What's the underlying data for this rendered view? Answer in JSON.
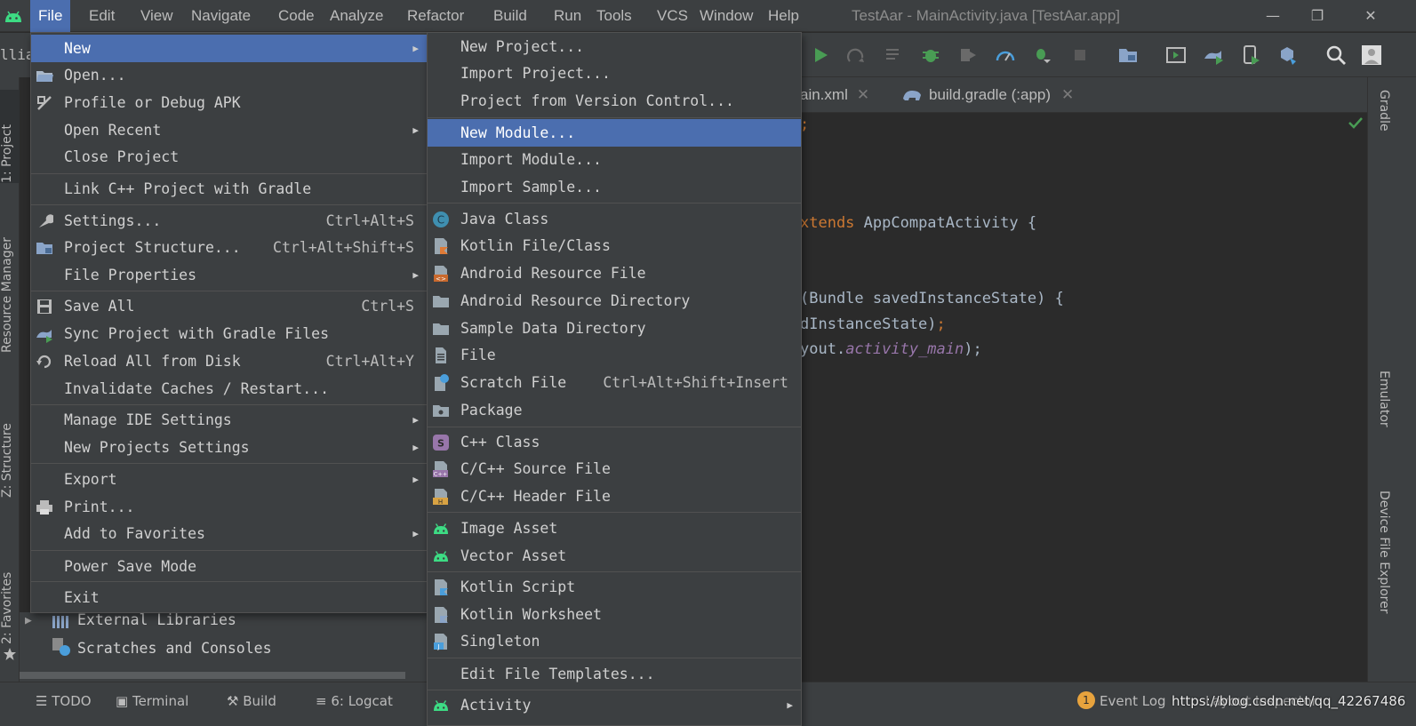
{
  "menubar": {
    "items": [
      "File",
      "Edit",
      "View",
      "Navigate",
      "Code",
      "Analyze",
      "Refactor",
      "Build",
      "Run",
      "Tools",
      "VCS",
      "Window",
      "Help"
    ],
    "window_title": "TestAar - MainActivity.java [TestAar.app]"
  },
  "breadcrumb_fragment": "llia",
  "editor_tabs": [
    {
      "label": "ain.xml"
    },
    {
      "label": "build.gradle (:app)"
    }
  ],
  "code_lines": {
    "l1": ";",
    "l2_kw": "xtends",
    "l2_rest": " AppCompatActivity {",
    "l3": "(Bundle savedInstanceState) {",
    "l4a": "dInstanceState)",
    "l4b": ";",
    "l5a": "yout.",
    "l5b": "activity_main",
    "l5c": ");"
  },
  "file_menu": [
    {
      "label": "New",
      "arrow": true,
      "highlighted": true
    },
    {
      "label": "Open...",
      "icon": "folder-open-icon"
    },
    {
      "label": "Profile or Debug APK",
      "icon": "profile-apk-icon"
    },
    {
      "label": "Open Recent",
      "arrow": true
    },
    {
      "label": "Close Project"
    },
    {
      "label": "Link C++ Project with Gradle"
    },
    {
      "label": "Settings...",
      "shortcut": "Ctrl+Alt+S",
      "icon": "wrench-icon"
    },
    {
      "label": "Project Structure...",
      "shortcut": "Ctrl+Alt+Shift+S",
      "icon": "project-structure-icon"
    },
    {
      "label": "File Properties",
      "arrow": true
    },
    {
      "label": "Save All",
      "shortcut": "Ctrl+S",
      "icon": "save-all-icon"
    },
    {
      "label": "Sync Project with Gradle Files",
      "icon": "gradle-sync-icon"
    },
    {
      "label": "Reload All from Disk",
      "shortcut": "Ctrl+Alt+Y",
      "icon": "reload-icon"
    },
    {
      "label": "Invalidate Caches / Restart..."
    },
    {
      "label": "Manage IDE Settings",
      "arrow": true
    },
    {
      "label": "New Projects Settings",
      "arrow": true
    },
    {
      "label": "Export",
      "arrow": true
    },
    {
      "label": "Print...",
      "icon": "printer-icon"
    },
    {
      "label": "Add to Favorites",
      "arrow": true
    },
    {
      "label": "Power Save Mode"
    },
    {
      "label": "Exit"
    }
  ],
  "new_menu": [
    {
      "label": "New Project..."
    },
    {
      "label": "Import Project..."
    },
    {
      "label": "Project from Version Control..."
    },
    {
      "label": "New Module...",
      "highlighted": true
    },
    {
      "label": "Import Module..."
    },
    {
      "label": "Import Sample..."
    },
    {
      "label": "Java Class",
      "icon": "java-class-icon"
    },
    {
      "label": "Kotlin File/Class",
      "icon": "kotlin-file-icon"
    },
    {
      "label": "Android Resource File",
      "icon": "android-resource-file-icon"
    },
    {
      "label": "Android Resource Directory",
      "icon": "folder-icon"
    },
    {
      "label": "Sample Data Directory",
      "icon": "folder-icon"
    },
    {
      "label": "File",
      "icon": "file-icon"
    },
    {
      "label": "Scratch File",
      "shortcut": "Ctrl+Alt+Shift+Insert",
      "icon": "scratch-file-icon"
    },
    {
      "label": "Package",
      "icon": "package-icon"
    },
    {
      "label": "C++ Class",
      "icon": "cpp-class-icon"
    },
    {
      "label": "C/C++ Source File",
      "icon": "cpp-source-icon"
    },
    {
      "label": "C/C++ Header File",
      "icon": "cpp-header-icon"
    },
    {
      "label": "Image Asset",
      "icon": "android-icon"
    },
    {
      "label": "Vector Asset",
      "icon": "android-icon"
    },
    {
      "label": "Kotlin Script",
      "icon": "kotlin-script-icon"
    },
    {
      "label": "Kotlin Worksheet",
      "icon": "kotlin-worksheet-icon"
    },
    {
      "label": "Singleton",
      "icon": "singleton-icon"
    },
    {
      "label": "Edit File Templates..."
    },
    {
      "label": "Activity",
      "arrow": true,
      "icon": "android-icon"
    }
  ],
  "project_tree": {
    "external_libraries": "External Libraries",
    "scratches": "Scratches and Consoles"
  },
  "left_tabs": {
    "project": "1: Project",
    "resource_manager": "Resource Manager",
    "structure": "Z: Structure",
    "favorites": "2: Favorites"
  },
  "right_tabs": {
    "gradle": "Gradle",
    "emulator": "Emulator",
    "device_explorer": "Device File Explorer"
  },
  "status_bar": {
    "todo": "TODO",
    "terminal": "Terminal",
    "build": "Build",
    "logcat": "6: Logcat",
    "event_log_count": "1",
    "event_log": "Event Log",
    "layout_inspector": "Layout Inspector",
    "watermark": "https://blog.csdn.net/qq_42267486"
  },
  "colors": {
    "accent": "#4b6eaf",
    "android_green": "#3ddc84",
    "run_green": "#499c54"
  }
}
